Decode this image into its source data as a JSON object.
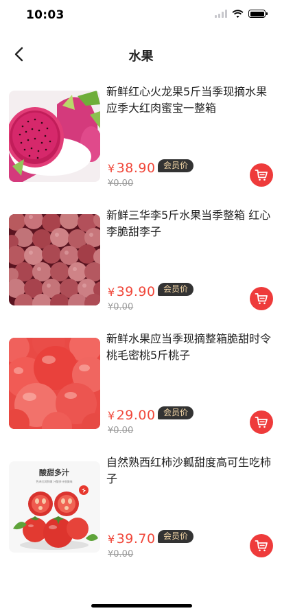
{
  "status": {
    "time": "10:03"
  },
  "nav": {
    "title": "水果"
  },
  "products": [
    {
      "title": "新鲜红心火龙果5斤当季现摘水果应季大红肉蜜宝一整箱",
      "currency": "¥",
      "price": "38.90",
      "badge": "会员价",
      "original_price": "¥0.00",
      "image": "dragon-fruit"
    },
    {
      "title": "新鲜三华李5斤水果当季整箱 红心李脆甜李子",
      "currency": "¥",
      "price": "39.90",
      "badge": "会员价",
      "original_price": "¥0.00",
      "image": "plums"
    },
    {
      "title": "新鲜水果应当季现摘整箱脆甜时令桃毛密桃5斤桃子",
      "currency": "¥",
      "price": "29.00",
      "badge": "会员价",
      "original_price": "¥0.00",
      "image": "peaches"
    },
    {
      "title": "自然熟西红柿沙瓤甜度高可生吃柿子",
      "currency": "¥",
      "price": "39.70",
      "badge": "会员价",
      "original_price": "¥0.00",
      "image": "tomatoes",
      "image_caption": "酸甜多汁",
      "image_subcaption": "色泽红润鲜嫩 汁酸多汁很美味"
    }
  ],
  "colors": {
    "accent": "#ee3b3b",
    "price": "#f0473a",
    "badge_bg": "#333333",
    "badge_text": "#f3d6a7"
  }
}
